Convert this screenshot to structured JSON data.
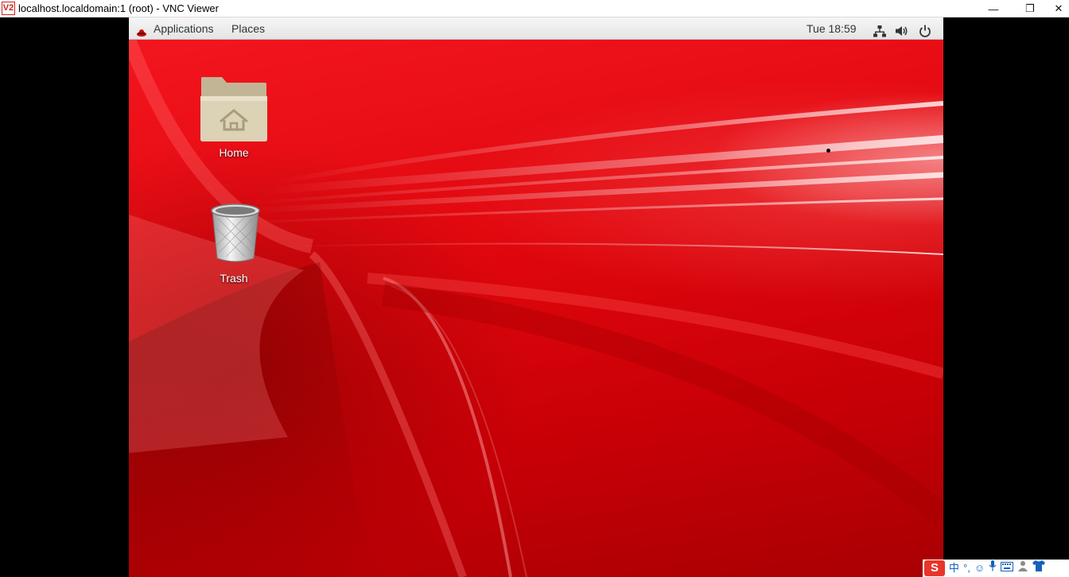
{
  "window": {
    "icon_text": "V2",
    "title": "localhost.localdomain:1 (root) - VNC Viewer",
    "controls": {
      "minimize": "—",
      "maximize": "❐",
      "close": "✕"
    }
  },
  "topbar": {
    "menu_applications": "Applications",
    "menu_places": "Places",
    "clock": "Tue 18:59",
    "icons": [
      "redhat-logo-icon",
      "network-icon",
      "volume-icon",
      "power-icon"
    ]
  },
  "desktop": {
    "icons": [
      {
        "label": "Home",
        "icon": "home-folder-icon"
      },
      {
        "label": "Trash",
        "icon": "trash-icon"
      }
    ]
  },
  "tray": {
    "sogou": "S",
    "items": [
      "中",
      "°,",
      "☺",
      "mic",
      "keyboard",
      "user",
      "shirt"
    ]
  },
  "colors": {
    "wallpaper_red": "#e0070d",
    "panel_gray": "#ececec",
    "folder_tan": "#d8cfb4"
  }
}
